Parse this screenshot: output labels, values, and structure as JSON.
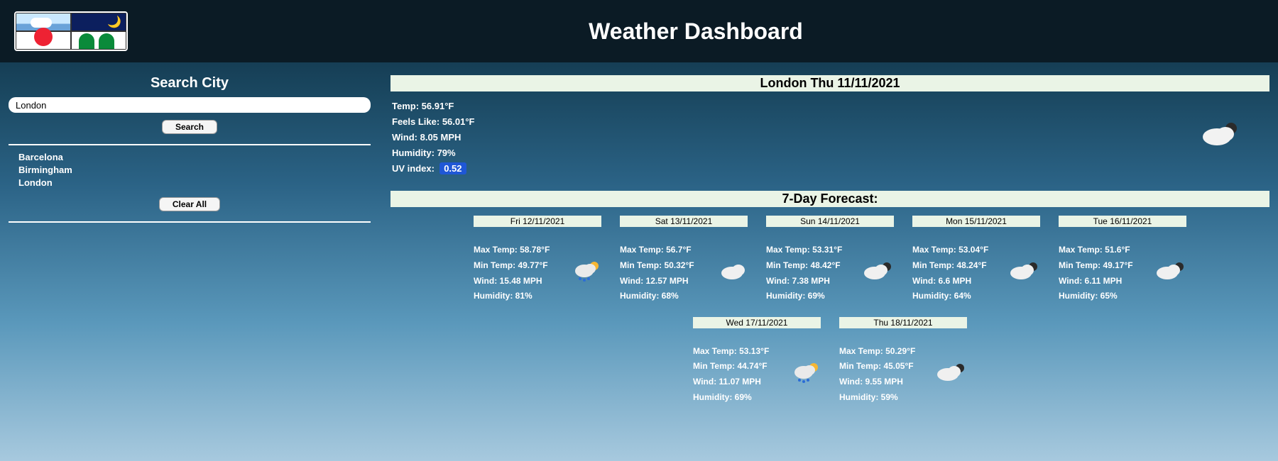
{
  "header": {
    "title": "Weather Dashboard",
    "logo_alt": "weather-logo"
  },
  "search": {
    "heading": "Search City",
    "input_value": "London",
    "search_label": "Search",
    "clear_label": "Clear All",
    "history": [
      "Barcelona",
      "Birmingham",
      "London"
    ]
  },
  "current": {
    "band": "London Thu 11/11/2021",
    "labels": {
      "temp": "Temp:",
      "feels": "Feels Like:",
      "wind": "Wind:",
      "humidity": "Humidity:",
      "uv": "UV index:"
    },
    "temp": "56.91°F",
    "feels": "56.01°F",
    "wind": "8.05 MPH",
    "humidity": "79%",
    "uv": "0.52",
    "icon": "cloud-moon-icon",
    "icon_glyph": "☁️🌙"
  },
  "forecast": {
    "heading": "7-Day Forecast:",
    "labels": {
      "max": "Max Temp:",
      "min": "Min Temp:",
      "wind": "Wind:",
      "humidity": "Humidity:"
    },
    "days": [
      {
        "date": "Fri 12/11/2021",
        "max": "58.78°F",
        "min": "49.77°F",
        "wind": "15.48 MPH",
        "humidity": "81%",
        "icon": "rain-sun-icon",
        "icon_glyph": "🌦️"
      },
      {
        "date": "Sat 13/11/2021",
        "max": "56.7°F",
        "min": "50.32°F",
        "wind": "12.57 MPH",
        "humidity": "68%",
        "icon": "cloud-icon",
        "icon_glyph": "☁️"
      },
      {
        "date": "Sun 14/11/2021",
        "max": "53.31°F",
        "min": "48.42°F",
        "wind": "7.38 MPH",
        "humidity": "69%",
        "icon": "cloud-moon-icon",
        "icon_glyph": "☁️🌙"
      },
      {
        "date": "Mon 15/11/2021",
        "max": "53.04°F",
        "min": "48.24°F",
        "wind": "6.6 MPH",
        "humidity": "64%",
        "icon": "cloud-moon-icon",
        "icon_glyph": "☁️🌙"
      },
      {
        "date": "Tue 16/11/2021",
        "max": "51.6°F",
        "min": "49.17°F",
        "wind": "6.11 MPH",
        "humidity": "65%",
        "icon": "cloud-moon-icon",
        "icon_glyph": "☁️🌙"
      },
      {
        "date": "Wed 17/11/2021",
        "max": "53.13°F",
        "min": "44.74°F",
        "wind": "11.07 MPH",
        "humidity": "69%",
        "icon": "rain-sun-icon",
        "icon_glyph": "🌦️"
      },
      {
        "date": "Thu 18/11/2021",
        "max": "50.29°F",
        "min": "45.05°F",
        "wind": "9.55 MPH",
        "humidity": "59%",
        "icon": "cloud-moon-icon",
        "icon_glyph": "☁️🌙"
      }
    ]
  }
}
